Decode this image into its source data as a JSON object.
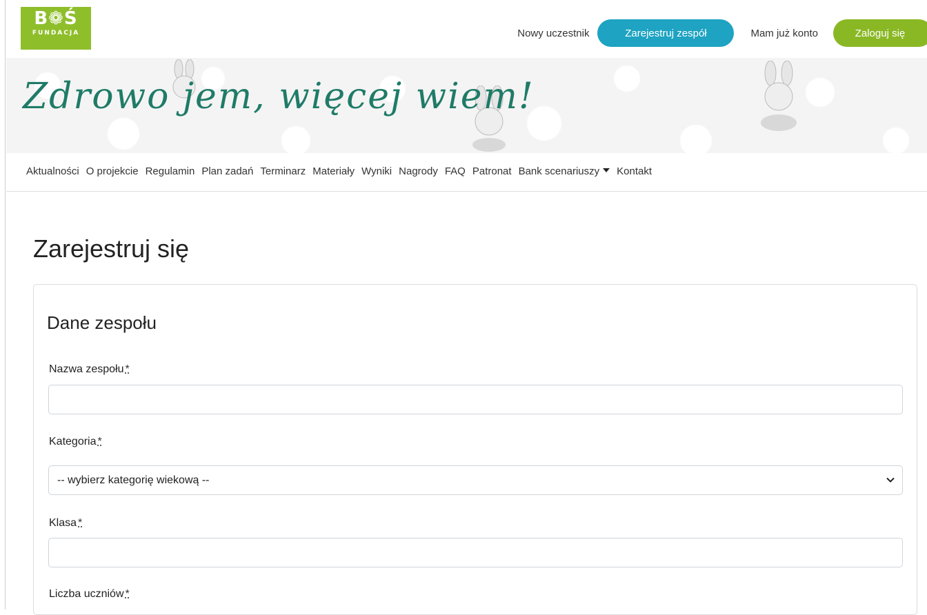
{
  "logo": {
    "top": "B❁Ś",
    "bottom": "FUNDACJA"
  },
  "header": {
    "new_participant_text": "Nowy uczestnik",
    "register_team_label": "Zarejestruj zespół",
    "has_account_text": "Mam już konto",
    "login_label": "Zaloguj się"
  },
  "banner": {
    "title": "Zdrowo jem, więcej wiem!"
  },
  "nav": {
    "items": [
      "Aktualności",
      "O projekcie",
      "Regulamin",
      "Plan zadań",
      "Terminarz",
      "Materiały",
      "Wyniki",
      "Nagrody",
      "FAQ",
      "Patronat",
      "Bank scenariuszy",
      "Kontakt"
    ]
  },
  "page": {
    "title": "Zarejestruj się"
  },
  "form": {
    "section_title": "Dane zespołu",
    "required_mark": "*",
    "team_name_label": "Nazwa zespołu",
    "team_name_value": "",
    "category_label": "Kategoria",
    "category_selected": "-- wybierz kategorię wiekową --",
    "class_label": "Klasa",
    "class_value": "",
    "students_label": "Liczba uczniów"
  },
  "colors": {
    "accent_blue": "#1ea3c2",
    "accent_green": "#8ab825",
    "banner_title": "#1f7b67"
  }
}
